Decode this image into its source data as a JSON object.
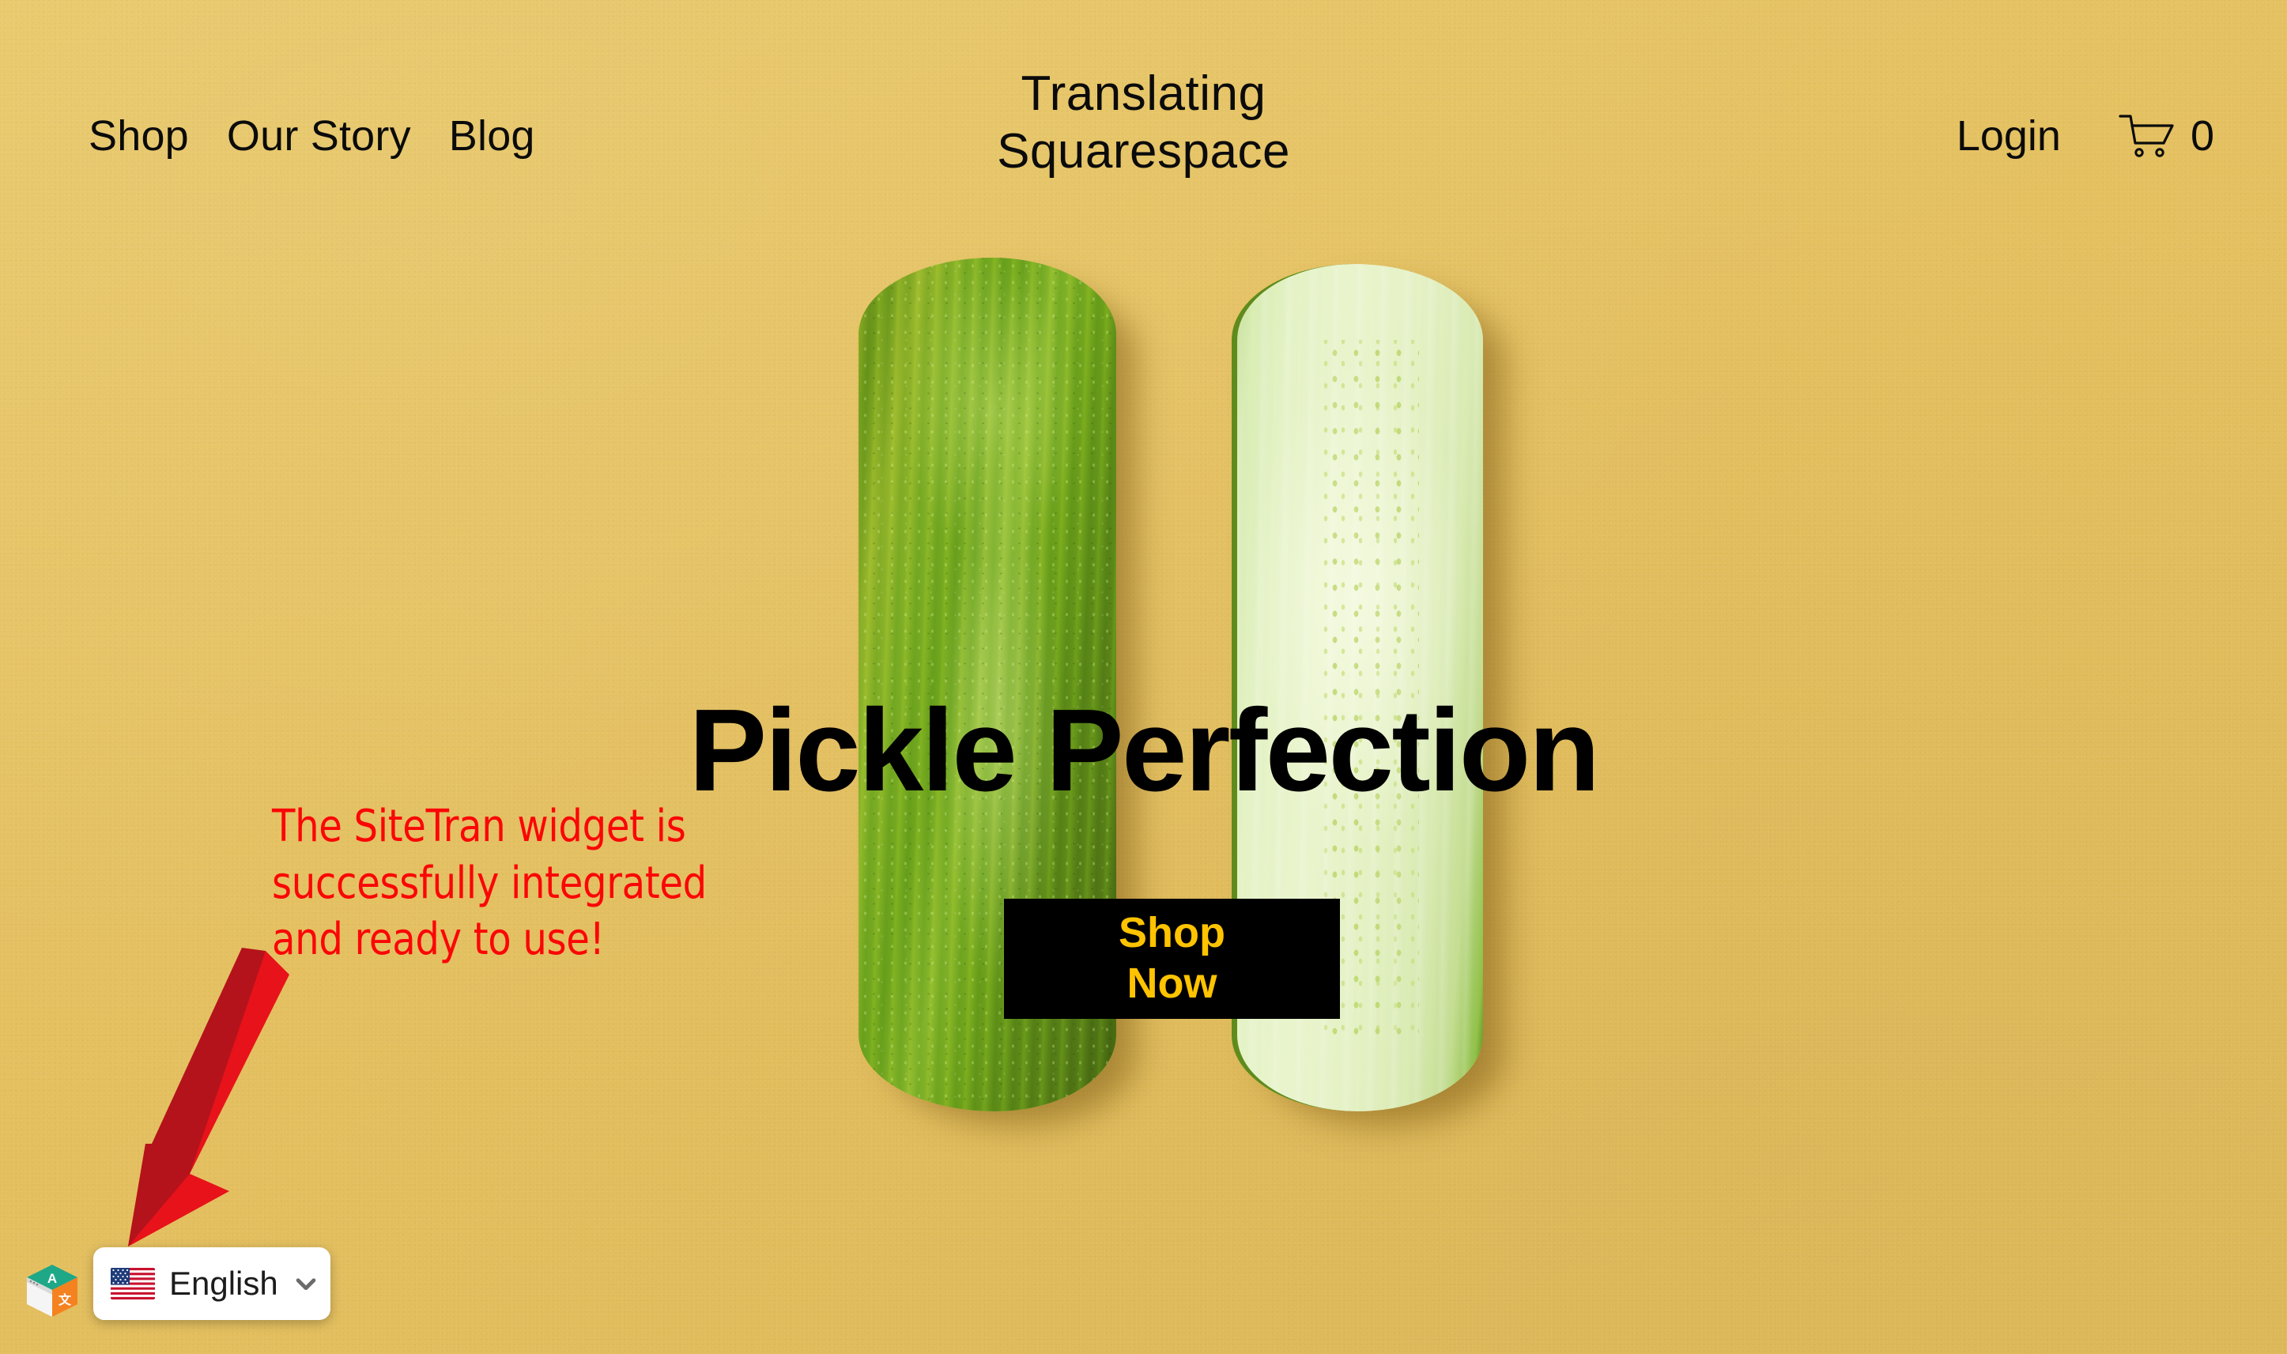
{
  "page": {
    "background_color": "#e5c263",
    "accent_black": "#000000",
    "cta_text_color": "#ffc300",
    "annotation_color": "#fb0606"
  },
  "header": {
    "site_title_line1": "Translating",
    "site_title_line2": "Squarespace",
    "nav_links": [
      {
        "label": "Shop"
      },
      {
        "label": "Our Story"
      },
      {
        "label": "Blog"
      }
    ],
    "login_label": "Login",
    "cart": {
      "icon": "shopping-cart-icon",
      "count": "0"
    }
  },
  "hero": {
    "headline": "Pickle Perfection",
    "cta": {
      "line1": "Shop",
      "line2": "Now"
    },
    "image_alt": "whole-pickle-and-halved-pickle"
  },
  "annotation": {
    "text": "The SiteTran widget is\nsuccessfully integrated\nand ready to use!",
    "arrow_icon": "down-left-arrow-icon",
    "arrow_color": "#e8121a",
    "arrow_shadow_color": "#b4131b"
  },
  "sitetran_widget": {
    "logo_icon": "sitetran-cube-logo-icon",
    "logo_colors": {
      "top": "#1fa887",
      "right": "#f58220",
      "left": "#f2f2f2"
    },
    "flag_icon": "us-flag-icon",
    "language_label": "English",
    "chevron_icon": "chevron-down-icon",
    "chevron_color": "#6b6b6b"
  }
}
